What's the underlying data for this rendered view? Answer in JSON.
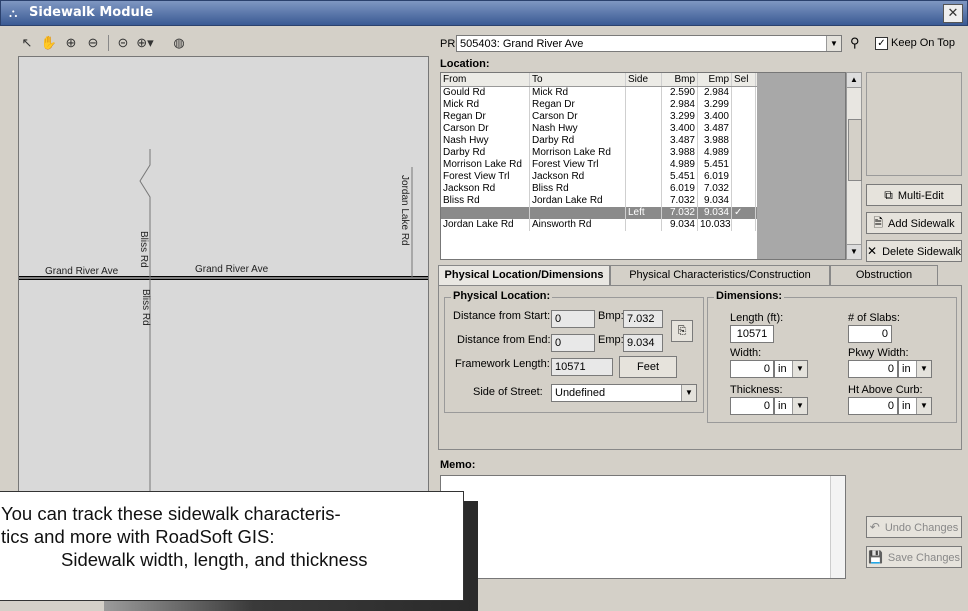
{
  "window": {
    "title": "Sidewalk Module",
    "close_glyph": "✕"
  },
  "toolbar": {
    "icons": [
      "pointer-icon",
      "pan-hand-icon",
      "zoom-in-icon",
      "zoom-out-icon",
      "zoom-extent-icon",
      "zoom-menu-icon",
      "globe-icon"
    ]
  },
  "map": {
    "labels": {
      "bliss_rd_top": "Bliss Rd",
      "bliss_rd_bottom": "Bliss Rd",
      "jordan_lake_rd": "Jordan Lake Rd",
      "grand_river_left": "Grand River Ave",
      "grand_river_right": "Grand River Ave"
    }
  },
  "pr": {
    "label": "PR:",
    "value": "505403: Grand River Ave",
    "keep_on_top": "Keep On Top",
    "keep_on_top_checked": true
  },
  "location": {
    "label": "Location:",
    "columns": [
      "From",
      "To",
      "Side",
      "Bmp",
      "Emp",
      "Sel"
    ],
    "rows": [
      [
        "Gould Rd",
        "Mick Rd",
        "",
        "2.590",
        "2.984",
        ""
      ],
      [
        "Mick Rd",
        "Regan Dr",
        "",
        "2.984",
        "3.299",
        ""
      ],
      [
        "Regan Dr",
        "Carson Dr",
        "",
        "3.299",
        "3.400",
        ""
      ],
      [
        "Carson Dr",
        "Nash Hwy",
        "",
        "3.400",
        "3.487",
        ""
      ],
      [
        "Nash Hwy",
        "Darby Rd",
        "",
        "3.487",
        "3.988",
        ""
      ],
      [
        "Darby Rd",
        "Morrison Lake Rd",
        "",
        "3.988",
        "4.989",
        ""
      ],
      [
        "Morrison Lake Rd",
        "Forest View Trl",
        "",
        "4.989",
        "5.451",
        ""
      ],
      [
        "Forest View Trl",
        "Jackson Rd",
        "",
        "5.451",
        "6.019",
        ""
      ],
      [
        "Jackson Rd",
        "Bliss Rd",
        "",
        "6.019",
        "7.032",
        ""
      ],
      [
        "Bliss Rd",
        "Jordan Lake Rd",
        "",
        "7.032",
        "9.034",
        ""
      ],
      [
        "",
        "",
        "Left",
        "7.032",
        "9.034",
        "✓"
      ],
      [
        "Jordan Lake Rd",
        "Ainsworth Rd",
        "",
        "9.034",
        "10.033",
        ""
      ]
    ]
  },
  "buttons": {
    "multi_edit": "Multi-Edit",
    "add_sidewalk": "Add Sidewalk",
    "delete_sidewalk": "Delete Sidewalk",
    "undo": "Undo Changes",
    "save": "Save Changes"
  },
  "tabs": [
    "Physical Location/Dimensions",
    "Physical Characteristics/Construction",
    "Obstruction"
  ],
  "physical_location": {
    "title": "Physical Location:",
    "dist_start_label": "Distance from Start:",
    "dist_start": "0",
    "bmp_label": "Bmp:",
    "bmp": "7.032",
    "dist_end_label": "Distance from End:",
    "dist_end": "0",
    "emp_label": "Emp:",
    "emp": "9.034",
    "framework_label": "Framework Length:",
    "framework": "10571",
    "units_button": "Feet",
    "side_label": "Side of Street:",
    "side": "Undefined"
  },
  "dimensions": {
    "title": "Dimensions:",
    "length_label": "Length (ft):",
    "length": "10571",
    "slabs_label": "# of Slabs:",
    "slabs": "0",
    "width_label": "Width:",
    "width": "0",
    "width_unit": "in",
    "pkwy_label": "Pkwy Width:",
    "pkwy": "0",
    "pkwy_unit": "in",
    "thickness_label": "Thickness:",
    "thickness": "0",
    "thickness_unit": "in",
    "curb_label": "Ht Above Curb:",
    "curb": "0",
    "curb_unit": "in"
  },
  "memo": {
    "label": "Memo:",
    "text": ""
  },
  "callout": {
    "line1": "You can track these sidewalk characteris-",
    "line2": "tics and more with RoadSoft GIS:",
    "line3": "Sidewalk width, length, and thickness"
  }
}
